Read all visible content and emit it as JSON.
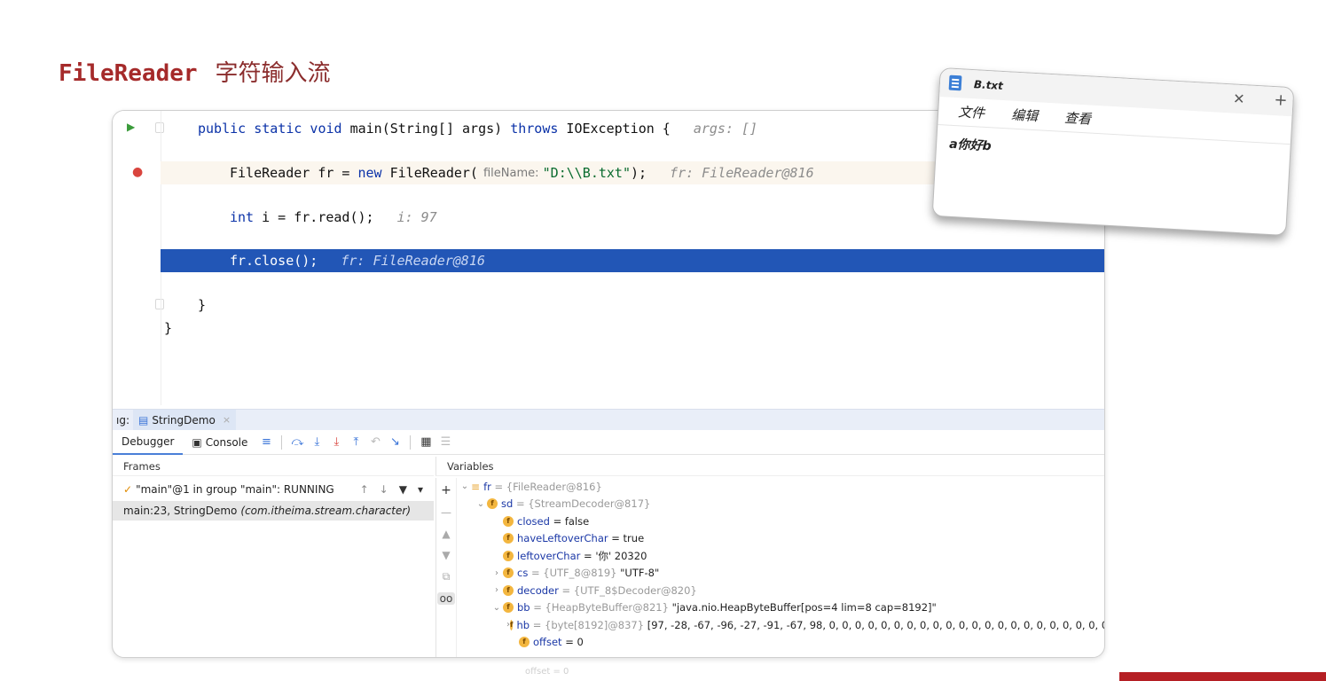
{
  "slide": {
    "title_code": "FileReader",
    "title_cn": "字符输入流"
  },
  "editor": {
    "line1": {
      "kw1": "public static void",
      "rest": " main(String[] args) ",
      "kw2": "throws",
      "rest2": " IOException {",
      "hint": "args: []"
    },
    "line2": {
      "code1": "FileReader fr = ",
      "kw": "new",
      "code2": " FileReader(",
      "param": "fileName: ",
      "str": "\"D:\\\\B.txt\"",
      "code3": ");",
      "hint": "fr: FileReader@816"
    },
    "line3": {
      "kw": "int",
      "code": " i = fr.read();",
      "hint": "i: 97"
    },
    "line4": {
      "code": "fr.close();",
      "hint": "fr: FileReader@816"
    },
    "line5": "}",
    "line6": "}"
  },
  "debug": {
    "tab_prefix": "ıg:",
    "tab_name": "StringDemo",
    "tabs": [
      "Debugger",
      "Console"
    ],
    "frames_header": "Frames",
    "variables_header": "Variables",
    "thread": "\"main\"@1 in group \"main\": RUNNING",
    "frame": "main:23, StringDemo",
    "frame_pkg": "(com.itheima.stream.character)",
    "variables": [
      {
        "name": "fr",
        "meta": "= {FileReader@816}",
        "val": ""
      },
      {
        "name": "sd",
        "meta": "= {StreamDecoder@817}",
        "val": ""
      },
      {
        "name": "closed",
        "meta": "",
        "val": "= false"
      },
      {
        "name": "haveLeftoverChar",
        "meta": "",
        "val": "= true"
      },
      {
        "name": "leftoverChar",
        "meta": "",
        "val": "= '你' 20320"
      },
      {
        "name": "cs",
        "meta": "= {UTF_8@819}",
        "val": "\"UTF-8\""
      },
      {
        "name": "decoder",
        "meta": "= {UTF_8$Decoder@820}",
        "val": ""
      },
      {
        "name": "bb",
        "meta": "= {HeapByteBuffer@821}",
        "val": "\"java.nio.HeapByteBuffer[pos=4 lim=8 cap=8192]\""
      },
      {
        "name": "hb",
        "meta": "= {byte[8192]@837}",
        "val": "[97, -28, -67, -96, -27, -91, -67, 98, 0, 0, 0, 0, 0, 0, 0, 0, 0, 0, 0, 0, 0, 0, 0, 0, 0, 0, 0, 0, 0, 0, 0, 0, C"
      },
      {
        "name": "offset",
        "meta": "",
        "val": "= 0"
      }
    ],
    "ghost": "offset = 0"
  },
  "notepad": {
    "title": "B.txt",
    "menu": [
      "文件",
      "编辑",
      "查看"
    ],
    "content": "a你好b"
  }
}
